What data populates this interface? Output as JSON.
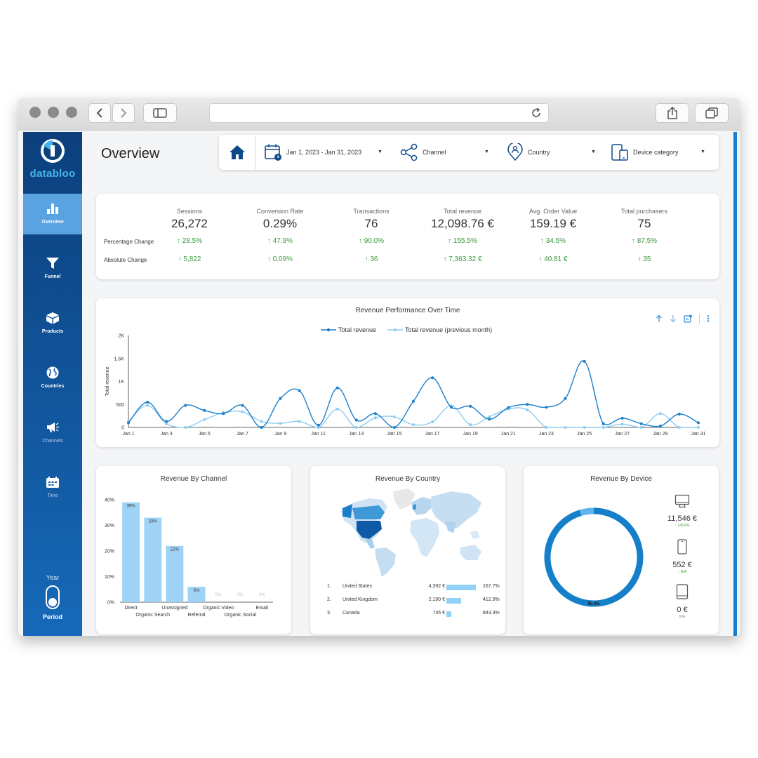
{
  "brand": {
    "name": "databloo"
  },
  "sidebar": {
    "items": [
      {
        "label": "Overview",
        "icon": "bar-chart-icon",
        "active": true
      },
      {
        "label": "Funnel",
        "icon": "funnel-icon"
      },
      {
        "label": "Products",
        "icon": "box-icon"
      },
      {
        "label": "Countries",
        "icon": "globe-icon"
      },
      {
        "label": "Channels",
        "icon": "megaphone-icon"
      },
      {
        "label": "Time",
        "icon": "calendar-icon"
      }
    ],
    "period": {
      "year_label": "Year",
      "label": "Period"
    }
  },
  "header": {
    "title": "Overview",
    "filters": {
      "date": "Jan 1, 2023 - Jan 31, 2023",
      "channel": "Channel",
      "country": "Country",
      "device": "Device category"
    }
  },
  "kpis": {
    "row_labels": {
      "pct": "Percentage Change",
      "abs": "Absolute Change"
    },
    "items": [
      {
        "label": "Sessions",
        "value": "26,272",
        "pct": "28.5%",
        "abs": "5,822"
      },
      {
        "label": "Conversion Rate",
        "value": "0.29%",
        "pct": "47.9%",
        "abs": "0.09%"
      },
      {
        "label": "Transactions",
        "value": "76",
        "pct": "90.0%",
        "abs": "36"
      },
      {
        "label": "Total revenue",
        "value": "12,098.76 €",
        "pct": "155.5%",
        "abs": "7,363.32 €"
      },
      {
        "label": "Avg. Order Value",
        "value": "159.19 €",
        "pct": "34.5%",
        "abs": "40.81 €"
      },
      {
        "label": "Total purchasers",
        "value": "75",
        "pct": "87.5%",
        "abs": "35"
      }
    ]
  },
  "revenue_chart": {
    "title": "Revenue Performance Over Time",
    "legend": [
      "Total revenue",
      "Total revenue (previous month)"
    ],
    "colors": [
      "#1a7ec9",
      "#8ecdf2"
    ]
  },
  "channel_card": {
    "title": "Revenue By Channel"
  },
  "country_card": {
    "title": "Revenue By Country",
    "rows": [
      {
        "rank": "1.",
        "country": "United States",
        "value": "4,392 €",
        "change": "167.7%",
        "share": 1.0
      },
      {
        "rank": "2.",
        "country": "United Kingdom",
        "value": "2,190 €",
        "change": "412.9%",
        "share": 0.5
      },
      {
        "rank": "3.",
        "country": "Canada",
        "value": "745 €",
        "change": "843.3%",
        "share": 0.17
      }
    ]
  },
  "device_card": {
    "title": "Revenue By Device",
    "devices": [
      {
        "icon": "desktop-icon",
        "value": "11,546 €",
        "change": "143.6%"
      },
      {
        "icon": "mobile-icon",
        "value": "552 €",
        "change": "N/A"
      },
      {
        "icon": "tablet-icon",
        "value": "0 €",
        "change": "N/A"
      }
    ]
  },
  "chart_data": [
    {
      "type": "line",
      "title": "Revenue Performance Over Time",
      "xlabel": "",
      "ylabel": "Total revenue",
      "ylim": [
        0,
        2000
      ],
      "yticks": [
        "0",
        "500",
        "1K",
        "1.5K",
        "2K"
      ],
      "ytick_values": [
        0,
        500,
        1000,
        1500,
        2000
      ],
      "x": [
        "Jan 1",
        "Jan 2",
        "Jan 3",
        "Jan 4",
        "Jan 5",
        "Jan 6",
        "Jan 7",
        "Jan 8",
        "Jan 9",
        "Jan 10",
        "Jan 11",
        "Jan 12",
        "Jan 13",
        "Jan 14",
        "Jan 15",
        "Jan 16",
        "Jan 17",
        "Jan 18",
        "Jan 19",
        "Jan 20",
        "Jan 21",
        "Jan 22",
        "Jan 23",
        "Jan 24",
        "Jan 25",
        "Jan 26",
        "Jan 27",
        "Jan 28",
        "Jan 29",
        "Jan 30",
        "Jan 31"
      ],
      "xtick_labels": [
        "Jan 1",
        "Jan 3",
        "Jan 5",
        "Jan 7",
        "Jan 9",
        "Jan 11",
        "Jan 13",
        "Jan 15",
        "Jan 17",
        "Jan 19",
        "Jan 21",
        "Jan 23",
        "Jan 25",
        "Jan 27",
        "Jan 29",
        "Jan 31"
      ],
      "series": [
        {
          "name": "Total revenue",
          "values": [
            100,
            550,
            130,
            480,
            370,
            300,
            480,
            0,
            630,
            800,
            50,
            860,
            160,
            300,
            0,
            570,
            1080,
            440,
            460,
            180,
            430,
            500,
            440,
            630,
            1440,
            80,
            200,
            80,
            30,
            290,
            100
          ]
        },
        {
          "name": "Total revenue (previous month)",
          "values": [
            130,
            480,
            80,
            0,
            170,
            320,
            340,
            130,
            90,
            130,
            0,
            400,
            0,
            210,
            230,
            60,
            120,
            470,
            60,
            230,
            400,
            380,
            0,
            0,
            0,
            0,
            70,
            0,
            300,
            0,
            0
          ]
        }
      ]
    },
    {
      "type": "bar",
      "title": "Revenue By Channel",
      "categories": [
        "Direct",
        "Organic Search",
        "Unassigned",
        "Referral",
        "Organic Video",
        "Organic Social",
        "Email"
      ],
      "values": [
        39,
        33,
        22,
        6,
        0,
        0,
        0
      ],
      "data_labels": [
        "39%",
        "33%",
        "22%",
        "6%",
        "0%",
        "0%",
        "0%"
      ],
      "yticks": [
        "0%",
        "10%",
        "20%",
        "30%",
        "40%"
      ],
      "ylim": [
        0,
        40
      ]
    },
    {
      "type": "pie",
      "title": "Revenue By Device",
      "labels": [
        "Desktop",
        "Mobile",
        "Tablet"
      ],
      "values": [
        95.4,
        4.6,
        0
      ],
      "data_label": "95.4%"
    }
  ]
}
